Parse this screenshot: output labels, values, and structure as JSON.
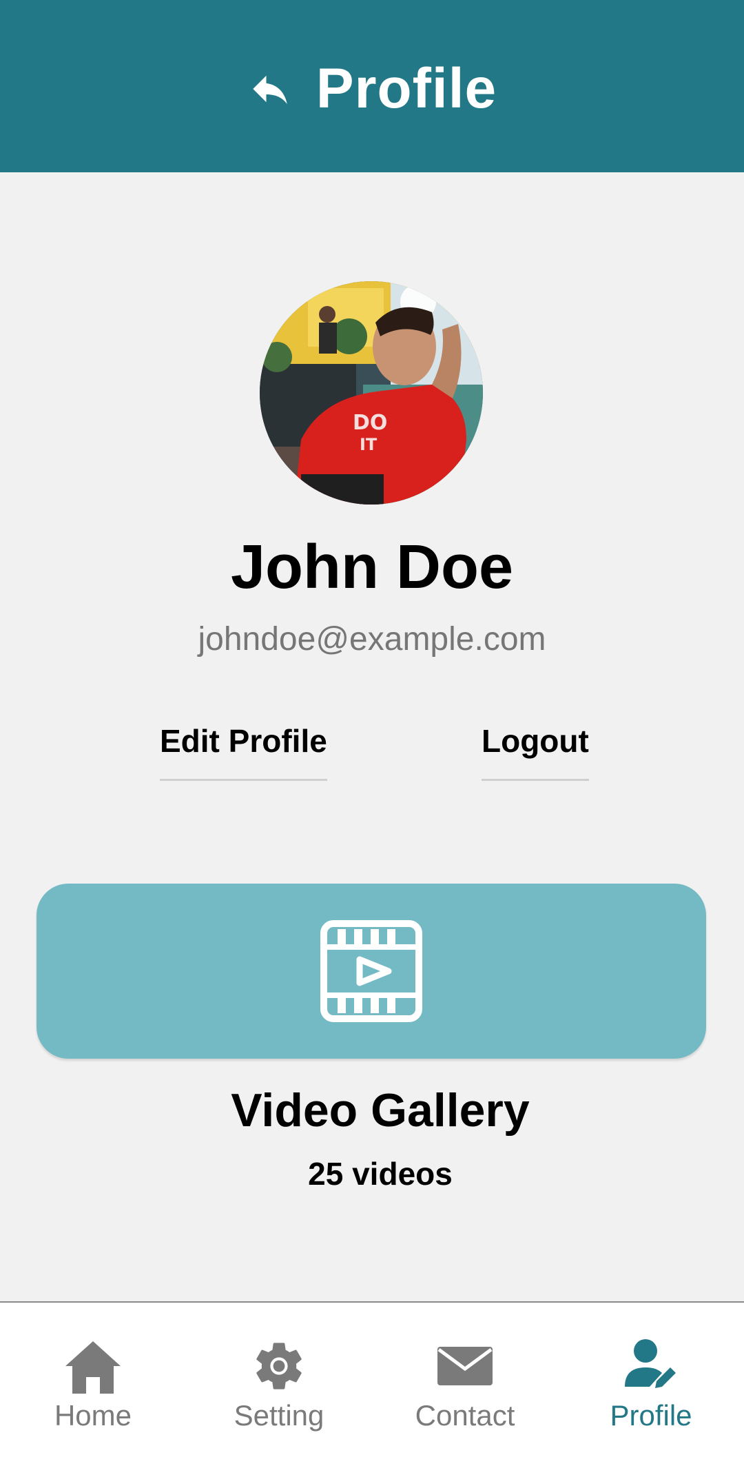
{
  "header": {
    "title": "Profile",
    "back_icon": "back-arrow-icon",
    "background_color": "#227886"
  },
  "profile": {
    "name": "John Doe",
    "email": "johndoe@example.com",
    "avatar_description_icon": "avatar-photo"
  },
  "actions": {
    "edit_profile_label": "Edit Profile",
    "logout_label": "Logout"
  },
  "gallery": {
    "icon": "video-film-icon",
    "title": "Video Gallery",
    "count_label": "25 videos",
    "card_color": "#74bac4"
  },
  "bottom_nav": {
    "items": [
      {
        "label": "Home",
        "icon": "home-icon",
        "active": false
      },
      {
        "label": "Setting",
        "icon": "gear-icon",
        "active": false
      },
      {
        "label": "Contact",
        "icon": "mail-icon",
        "active": false
      },
      {
        "label": "Profile",
        "icon": "user-edit-icon",
        "active": true
      }
    ],
    "inactive_color": "#7a7a7a",
    "active_color": "#227886"
  }
}
